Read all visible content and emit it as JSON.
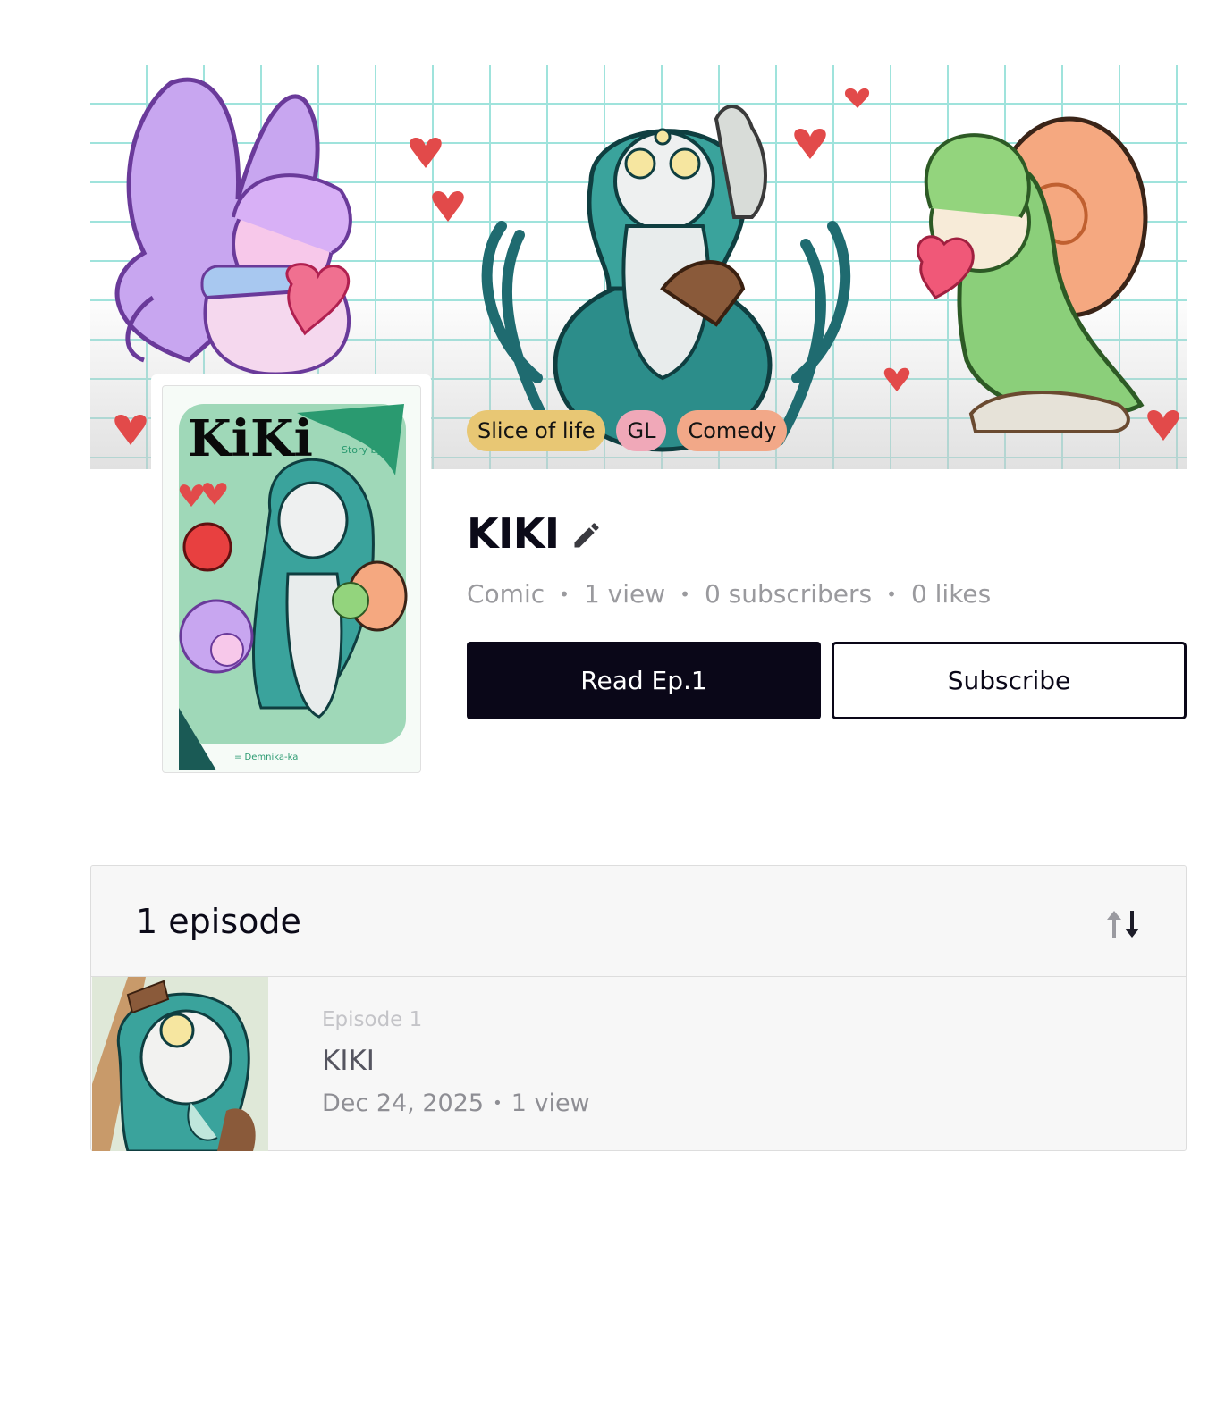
{
  "tags": [
    "Slice of life",
    "GL",
    "Comedy"
  ],
  "series": {
    "title": "KIKI",
    "type": "Comic",
    "views": "1 view",
    "subscribers": "0 subscribers",
    "likes": "0 likes"
  },
  "actions": {
    "read_label": "Read Ep.1",
    "subscribe_label": "Subscribe"
  },
  "cover": {
    "logo_text": "KiKi",
    "story_by": "Story by: Demnika-ka",
    "footer": "= Demnika-ka"
  },
  "episodes": {
    "count_label": "1 episode",
    "items": [
      {
        "label": "Episode 1",
        "title": "KIKI",
        "date": "Dec 24, 2025",
        "views": "1 view"
      }
    ]
  },
  "icons": {
    "edit": "pencil-icon",
    "sort": "sort-arrows-icon"
  },
  "colors": {
    "primary": "#0a0718",
    "tag_slice": "#e8c774",
    "tag_gl": "#f0a8b8",
    "tag_comedy": "#f2a888"
  }
}
